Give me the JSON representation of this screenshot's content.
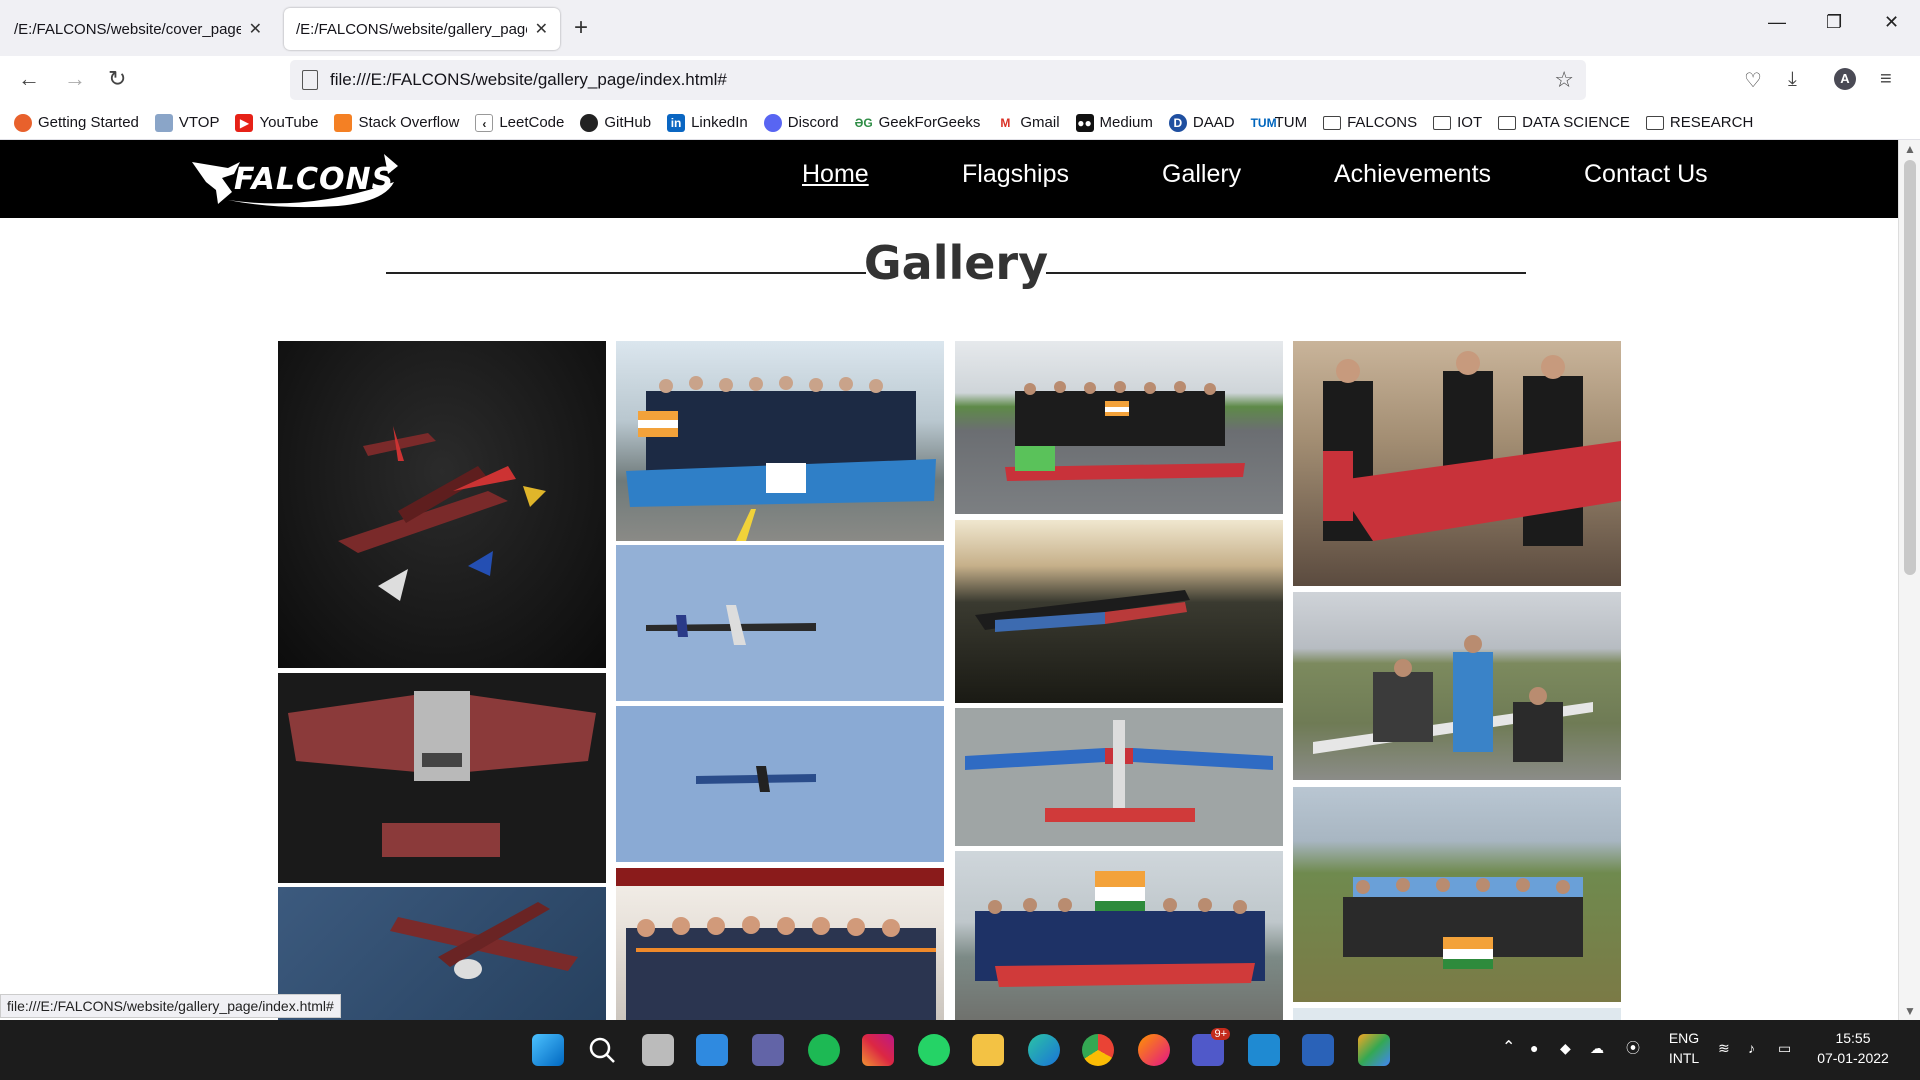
{
  "browser": {
    "tabs": [
      {
        "title": "/E:/FALCONS/website/cover_page/i",
        "active": false
      },
      {
        "title": "/E:/FALCONS/website/gallery_page/",
        "active": true
      }
    ],
    "url": "file:///E:/FALCONS/website/gallery_page/index.html#",
    "profile_initial": "A",
    "bookmarks": [
      {
        "label": "Getting Started",
        "icon": "firefox-icon"
      },
      {
        "label": "VTOP",
        "icon": "vtop-icon"
      },
      {
        "label": "YouTube",
        "icon": "youtube-icon"
      },
      {
        "label": "Stack Overflow",
        "icon": "stackoverflow-icon"
      },
      {
        "label": "LeetCode",
        "icon": "leetcode-icon"
      },
      {
        "label": "GitHub",
        "icon": "github-icon"
      },
      {
        "label": "LinkedIn",
        "icon": "linkedin-icon"
      },
      {
        "label": "Discord",
        "icon": "discord-icon"
      },
      {
        "label": "GeekForGeeks",
        "icon": "gfg-icon"
      },
      {
        "label": "Gmail",
        "icon": "gmail-icon"
      },
      {
        "label": "Medium",
        "icon": "medium-icon"
      },
      {
        "label": "DAAD",
        "icon": "daad-icon"
      },
      {
        "label": "TUM",
        "icon": "tum-icon"
      },
      {
        "label": "FALCONS",
        "icon": "folder-icon"
      },
      {
        "label": "IOT",
        "icon": "folder-icon"
      },
      {
        "label": "DATA SCIENCE",
        "icon": "folder-icon"
      },
      {
        "label": "RESEARCH",
        "icon": "folder-icon"
      }
    ],
    "status_url": "file:///E:/FALCONS/website/gallery_page/index.html#"
  },
  "site": {
    "logo_text": "FALCONS",
    "nav": [
      "Home",
      "Flagships",
      "Gallery",
      "Achievements",
      "Contact Us"
    ],
    "current_nav": "Home",
    "gallery_title": "Gallery"
  },
  "gallery": {
    "photos": [
      {
        "name": "photo-aircraft-render-dark",
        "theme": "render-dark"
      },
      {
        "name": "photo-vulcan-render",
        "theme": "render-dark2"
      },
      {
        "name": "photo-aircraft-render-blue",
        "theme": "render-blue"
      },
      {
        "name": "photo-team-airavat",
        "theme": "team-day"
      },
      {
        "name": "photo-plane-sky-1",
        "theme": "sky"
      },
      {
        "name": "photo-plane-sky-2",
        "theme": "sky"
      },
      {
        "name": "photo-team-school",
        "theme": "team-indoor"
      },
      {
        "name": "photo-team-runway",
        "theme": "team-runway"
      },
      {
        "name": "photo-plane-dusk",
        "theme": "dusk"
      },
      {
        "name": "photo-plane-tarmac",
        "theme": "tarmac"
      },
      {
        "name": "photo-team-flag",
        "theme": "team-day"
      },
      {
        "name": "photo-expo-vit-213",
        "theme": "expo"
      },
      {
        "name": "photo-field-assembly",
        "theme": "field"
      },
      {
        "name": "photo-team-field",
        "theme": "field"
      },
      {
        "name": "photo-partial",
        "theme": "sky-light"
      }
    ]
  },
  "taskbar": {
    "lang_top": "ENG",
    "lang_bottom": "INTL",
    "time": "15:55",
    "date": "07-01-2022",
    "teams_badge": "9+"
  }
}
